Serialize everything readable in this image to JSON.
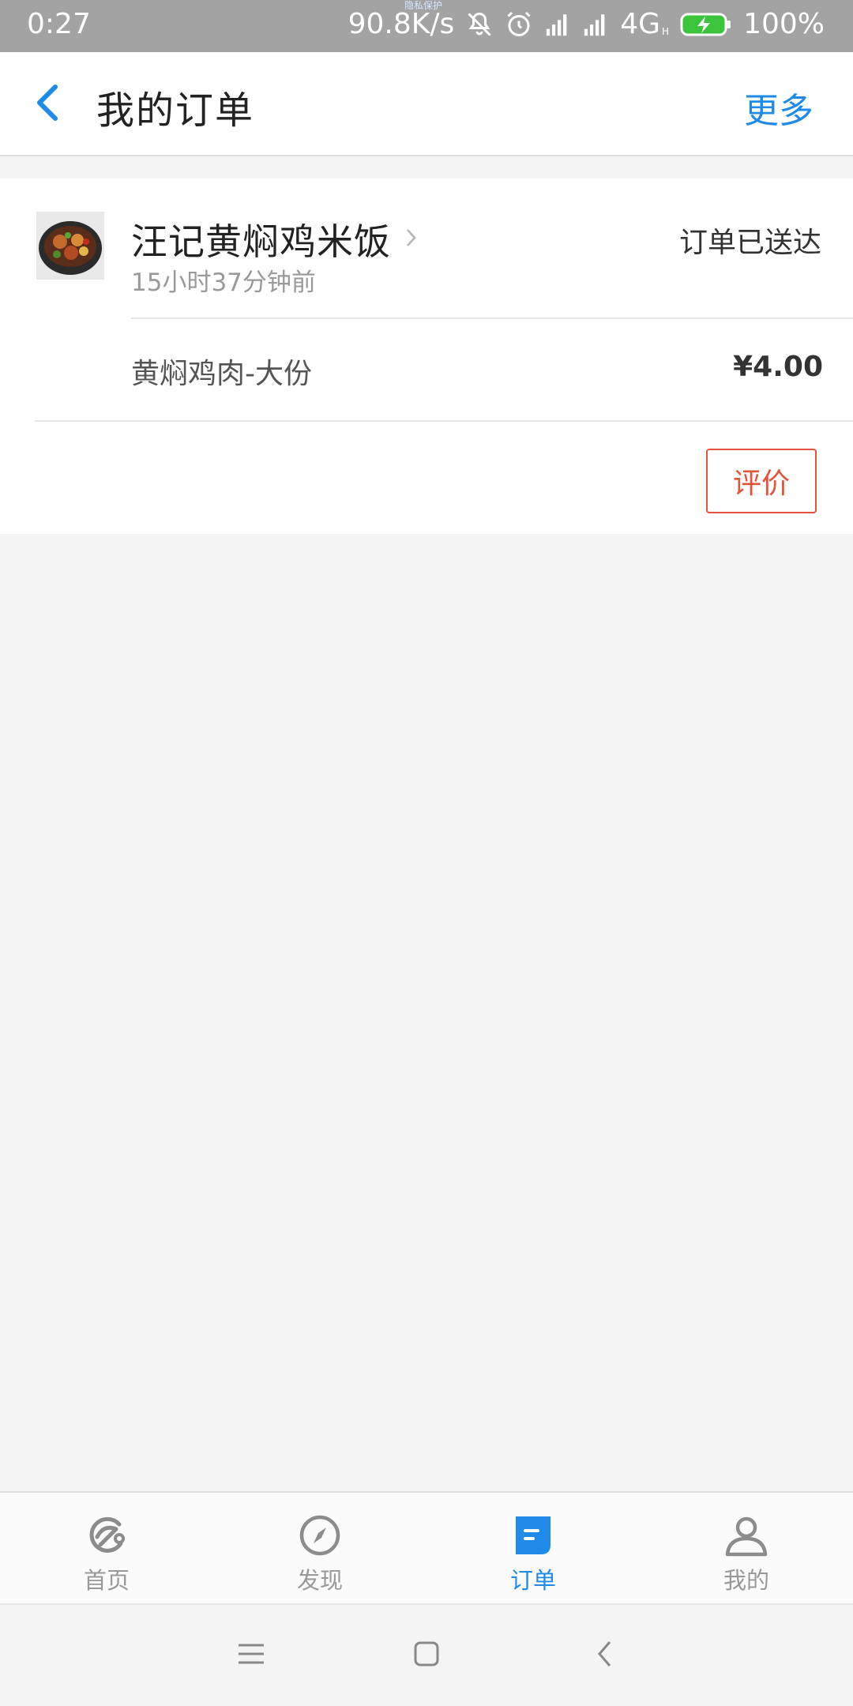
{
  "status_bar": {
    "time": "0:27",
    "notch_label": "隐私保护",
    "net_speed": "90.8K/s",
    "network": "4G",
    "network_sub": "H",
    "battery": "100%"
  },
  "header": {
    "title": "我的订单",
    "more_label": "更多"
  },
  "order": {
    "shop_name": "汪记黄焖鸡米饭",
    "time_ago": "15小时37分钟前",
    "status": "订单已送达",
    "item_name": "黄焖鸡肉-大份",
    "price": "¥4.00",
    "review_label": "评价"
  },
  "tabs": [
    {
      "label": "首页",
      "icon": "home-icon",
      "active": false
    },
    {
      "label": "发现",
      "icon": "compass-icon",
      "active": false
    },
    {
      "label": "订单",
      "icon": "order-icon",
      "active": true
    },
    {
      "label": "我的",
      "icon": "profile-icon",
      "active": false
    }
  ],
  "colors": {
    "accent": "#1f8ae8",
    "review": "#e4533b",
    "status_bar": "#a3a3a3",
    "page_bg": "#f4f4f4"
  }
}
